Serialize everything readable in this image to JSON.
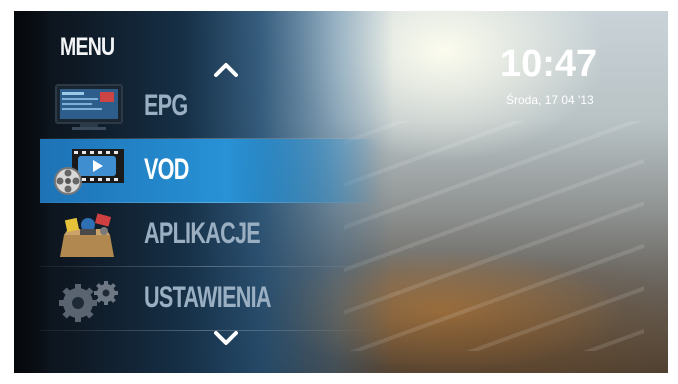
{
  "menu": {
    "title": "MENU",
    "items": [
      {
        "label": "EPG",
        "icon": "tv-icon",
        "active": false
      },
      {
        "label": "VOD",
        "icon": "film-reel-icon",
        "active": true
      },
      {
        "label": "APLIKACJE",
        "icon": "apps-box-icon",
        "active": false
      },
      {
        "label": "USTAWIENIA",
        "icon": "gears-icon",
        "active": false
      }
    ]
  },
  "clock": {
    "time": "10:47",
    "date": "Środa, 17 04 '13"
  },
  "colors": {
    "accent": "#2a8fd4",
    "panel": "#0f1a26",
    "text_inactive": "#9ab0c2"
  }
}
